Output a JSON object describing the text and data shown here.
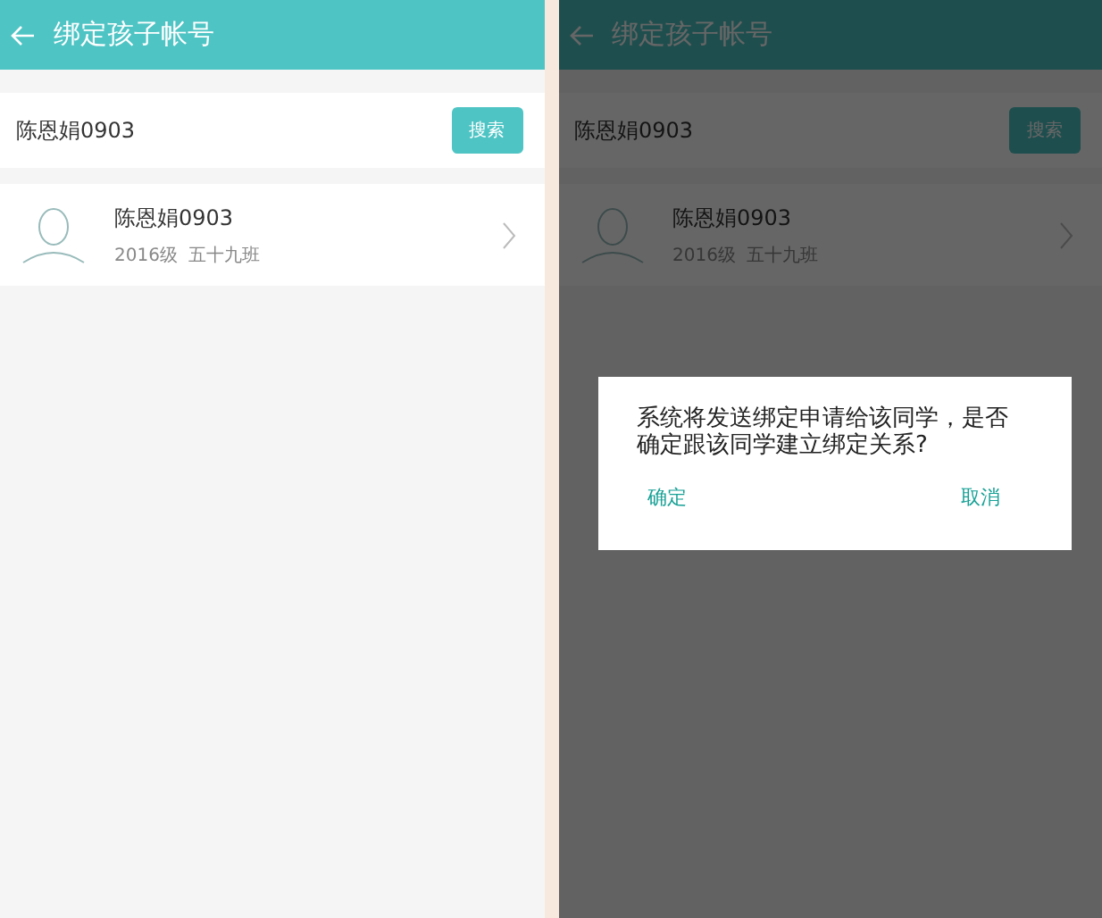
{
  "screens": [
    {
      "title": "绑定孩子帐号",
      "search": {
        "value": "陈恩娟0903",
        "button": "搜索"
      },
      "result": {
        "name": "陈恩娟0903",
        "grade": "2016级",
        "class": "五十九班"
      },
      "dimmed": false
    },
    {
      "title": "绑定孩子帐号",
      "search": {
        "value": "陈恩娟0903",
        "button": "搜索"
      },
      "result": {
        "name": "陈恩娟0903",
        "grade": "2016级",
        "class": "五十九班"
      },
      "dimmed": true,
      "dialog": {
        "message": "系统将发送绑定申请给该同学，是否确定跟该同学建立绑定关系?",
        "confirm": "确定",
        "cancel": "取消"
      }
    }
  ]
}
